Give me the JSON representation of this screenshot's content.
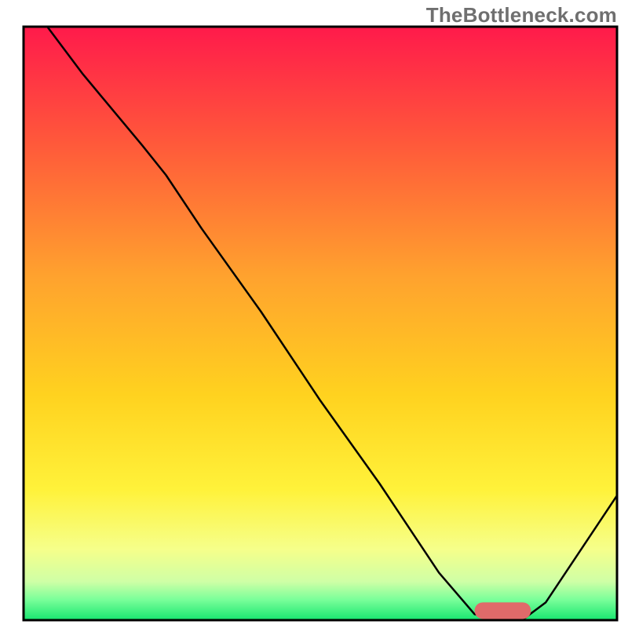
{
  "watermark": "TheBottleneck.com",
  "chart_data": {
    "type": "line",
    "title": "",
    "xlabel": "",
    "ylabel": "",
    "xlim": [
      0,
      100
    ],
    "ylim": [
      0,
      100
    ],
    "grid": false,
    "legend": false,
    "background": {
      "type": "vertical-gradient",
      "description": "Vertical gradient from red at top through orange and yellow to green at bottom, implying a bottleneck/heat scale where low y values are good (green) and high y values are bad (red).",
      "stops": [
        {
          "offset": 0.0,
          "color": "#ff1a4b"
        },
        {
          "offset": 0.2,
          "color": "#ff5a3a"
        },
        {
          "offset": 0.42,
          "color": "#ffa22e"
        },
        {
          "offset": 0.62,
          "color": "#ffd21f"
        },
        {
          "offset": 0.78,
          "color": "#fff23a"
        },
        {
          "offset": 0.88,
          "color": "#f6ff8a"
        },
        {
          "offset": 0.935,
          "color": "#cfffa6"
        },
        {
          "offset": 0.965,
          "color": "#7bff9a"
        },
        {
          "offset": 1.0,
          "color": "#17e670"
        }
      ]
    },
    "series": [
      {
        "name": "bottleneck-curve",
        "stroke": "#000000",
        "stroke_width": 2.5,
        "x": [
          4,
          10,
          20,
          24,
          30,
          40,
          50,
          60,
          70,
          76,
          80,
          84,
          88,
          100
        ],
        "y": [
          100,
          92,
          80,
          75,
          66,
          52,
          37,
          23,
          8,
          1,
          0,
          0,
          3,
          21
        ]
      }
    ],
    "optimal_marker": {
      "description": "Rounded red segment sitting on the green floor marking the optimal (zero-bottleneck) range.",
      "x_range": [
        76,
        85.5
      ],
      "y": 1.6,
      "height": 2.8,
      "color": "#e06a6a"
    },
    "frame": {
      "stroke": "#000000",
      "stroke_width": 3
    }
  }
}
